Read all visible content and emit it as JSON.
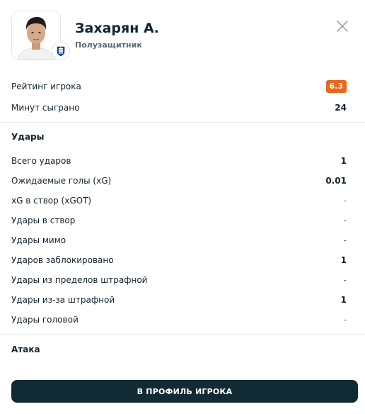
{
  "player": {
    "name": "Захарян А.",
    "position": "Полузащитник"
  },
  "summary": {
    "rating_label": "Рейтинг игрока",
    "rating_value": "6.3",
    "rating_color": "#e8661e",
    "minutes_label": "Минут сыграно",
    "minutes_value": "24"
  },
  "shots": {
    "title": "Удары",
    "rows": [
      {
        "label": "Всего ударов",
        "value": "1"
      },
      {
        "label": "Ожидаемые голы (xG)",
        "value": "0.01"
      },
      {
        "label": "xG в створ (xGOT)",
        "value": "-"
      },
      {
        "label": "Удары в створ",
        "value": "-"
      },
      {
        "label": "Удары мимо",
        "value": "-"
      },
      {
        "label": "Ударов заблокировано",
        "value": "1"
      },
      {
        "label": "Удары из пределов штрафной",
        "value": "-"
      },
      {
        "label": "Удары из-за штрафной",
        "value": "1"
      },
      {
        "label": "Удары головой",
        "value": "-"
      }
    ]
  },
  "attack": {
    "title": "Атака"
  },
  "button": {
    "label": "В ПРОФИЛЬ ИГРОКА",
    "color": "#112a33"
  },
  "icons": {
    "close": "close-icon",
    "club": "club-badge-icon"
  }
}
